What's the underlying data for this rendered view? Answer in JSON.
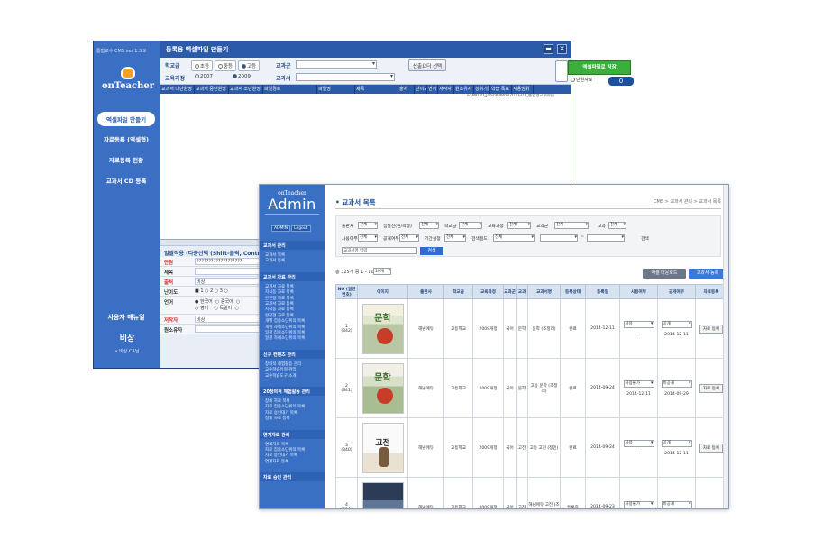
{
  "cms": {
    "version": "통합교수 CMS ver 1.3.9",
    "logo": "onTeacher",
    "title": "등록용 엑셀파일 만들기",
    "minimize": "▬",
    "close": "✕",
    "nav": [
      "엑셀파일 만들기",
      "자료등록 (엑셀형)",
      "자료등록 현황",
      "교과서 CD 등록"
    ],
    "manual": "사용자 매뉴얼",
    "brand": "비상",
    "brand_sub": "• 비상 CA님",
    "form": {
      "school_label": "학교급",
      "school_options": [
        "초등",
        "중등",
        "고등"
      ],
      "course_label": "교육과정",
      "course_options": [
        "2007",
        "2009"
      ],
      "subject_group_label": "교과군",
      "textbook_label": "교과서",
      "select_btn": "산출요더 선택",
      "excel_btn": "엑셀파일로 저장",
      "single_label": "단원자료",
      "count": "0",
      "path": "e:\\NKDD_jobs\\NPWW2013-07_통합형교수학습"
    },
    "grid_headers": [
      "교과서 대단원명",
      "교과서 중단원명",
      "교과서 소단원명",
      "파일경로",
      "파일명",
      "제목",
      "출처",
      "난이도",
      "언어",
      "저작자",
      "원소유자",
      "성취기준",
      "학습 목표",
      "사용범위"
    ],
    "detail": {
      "title": "일괄적용 (다중선택 (Shift-클릭, Control-클릭))",
      "rows": [
        {
          "label": "단원",
          "value": "???????????????????",
          "red": true
        },
        {
          "label": "제목",
          "value": ""
        },
        {
          "label": "출처",
          "value": "비상",
          "red": true
        },
        {
          "label": "난이도",
          "value": "■ 1   ○ 2   ○ 3   ○"
        },
        {
          "label": "언어",
          "value": "● 한국어  ○ 중국어  ○\n○ 영어    ○ 독일어  ○"
        },
        {
          "label": "저작자",
          "value": "비상",
          "red": true
        },
        {
          "label": "원소유자",
          "value": ""
        }
      ]
    }
  },
  "admin": {
    "logo_small": "onTeacher",
    "logo_big": "Admin",
    "session": [
      "ADMIN",
      "Logout"
    ],
    "sidebar": [
      {
        "section": "교과서 관리",
        "items": [
          "교과서 목록",
          "교과서 등록"
        ]
      },
      {
        "section": "교과서 자료 관리",
        "items": [
          "교과서 자료 목록",
          "지식동 자료 목록",
          "완진형 자료 목록",
          "교과서 자료 등록",
          "지식동 자료 등록",
          "완진형 자료 등록",
          "개별 집중소단위의 목록",
          "개별 자체소단위의 목록",
          "일괄 집중소단위의 목록",
          "일괄 자체소단위의 목록"
        ]
      },
      {
        "section": "신규 컨텐츠 관리",
        "items": [
          "창의적 체험활동 관리",
          "교수학습유형 관리",
          "교수학습도구 소개"
        ]
      },
      {
        "section": "20창의적 체험활동 관리",
        "items": [
          "창체 자료 목록",
          "자료 집중소단위의 목록",
          "자료 승인대기 목록",
          "창체 자료 등록"
        ]
      },
      {
        "section": "연계자료 관리",
        "items": [
          "연계자료 목록",
          "자료 집중소단위의 목록",
          "자료 승인대기 목록",
          "연계자료 등록"
        ]
      },
      {
        "section": "자료 승인 관리",
        "items": []
      }
    ],
    "title": "교과서 목록",
    "breadcrumb": "CMS > 교과서 관리 > 교과서 목록",
    "filters": {
      "row1": [
        {
          "label": "출판사",
          "value": "전체"
        },
        {
          "label": "집필진(원/곽형)",
          "value": "전체"
        },
        {
          "label": "학교급",
          "value": "전체"
        },
        {
          "label": "교육과정",
          "value": "전체"
        },
        {
          "label": "교과군",
          "value": "전체"
        },
        {
          "label": "교과",
          "value": "전체"
        }
      ],
      "row2": [
        {
          "label": "사용여부",
          "value": "전체"
        },
        {
          "label": "공개여부",
          "value": "전체"
        },
        {
          "label": "기간설정",
          "value": "전체"
        },
        {
          "label": "검색필드",
          "value": "전체"
        }
      ],
      "date_sep": "~",
      "period_label": "검색",
      "search_placeholder": "교과서명 입력",
      "search_btn": "검색"
    },
    "total": "총 325개 중 1 - 10",
    "per_page": "10개",
    "excel_download": "엑셀 다운로드",
    "register": "교과서 등록",
    "columns": [
      "NO (일련번호)",
      "이미지",
      "출판사",
      "학교급",
      "교육과정",
      "교과군",
      "교과",
      "교과서명",
      "등록상태",
      "등록일",
      "사용여부",
      "공개여부",
      "자료등록"
    ],
    "rows": [
      {
        "no": "1\n(342)",
        "publisher": "해냄에듀",
        "school": "고등학교",
        "course": "2009개정",
        "group": "국어",
        "subject": "문학",
        "name": "문학 (조정래)",
        "status": "완료",
        "date": "2014-12-11",
        "use": "사용",
        "use_date": "--",
        "open": "공개",
        "open_date": "2014-12-11",
        "btn": "자료 등록"
      },
      {
        "no": "2\n(341)",
        "publisher": "해냄에듀",
        "school": "고등학교",
        "course": "2009개정",
        "group": "국어",
        "subject": "문학",
        "name": "고등 문학 (조정래)",
        "status": "완료",
        "date": "2014-09-24",
        "use": "사용불가",
        "use_date": "2014-12-11",
        "open": "비공개",
        "open_date": "2014-09-29",
        "btn": "자료 등록"
      },
      {
        "no": "3\n(340)",
        "publisher": "해냄에듀",
        "school": "고등학교",
        "course": "2009개정",
        "group": "국어",
        "subject": "고전",
        "name": "고등 고전 (정민)",
        "status": "완료",
        "date": "2014-09-24",
        "use": "사용",
        "use_date": "--",
        "open": "공개",
        "open_date": "2014-12-11",
        "btn": "자료 등록"
      },
      {
        "no": "4\n(339)",
        "publisher": "해냄에듀",
        "school": "고등학교",
        "course": "2009개정",
        "group": "국어",
        "subject": "고전",
        "name": "해냄에듀 고전 (조정래)",
        "status": "등록중",
        "date": "2014-09-23",
        "use": "사용불가",
        "use_date": "",
        "open": "비공개",
        "open_date": "",
        "btn": ""
      }
    ]
  }
}
